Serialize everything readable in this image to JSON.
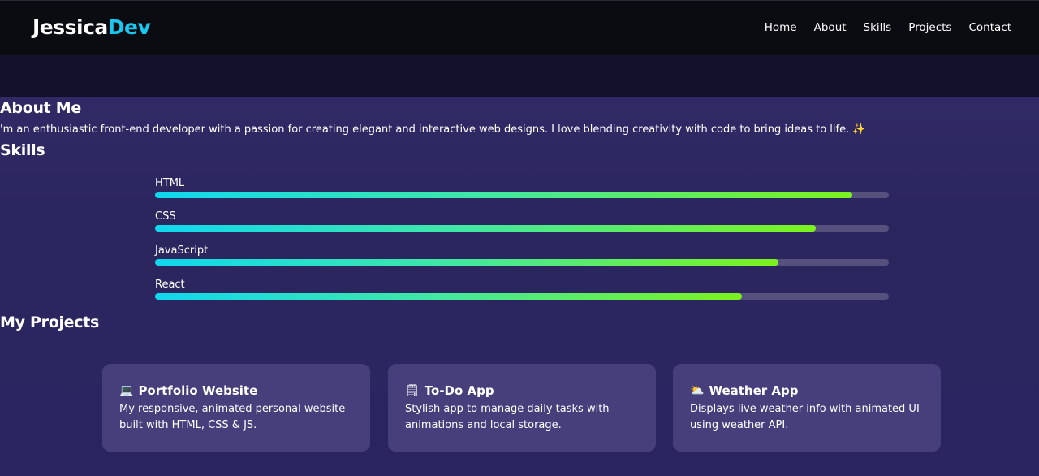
{
  "header": {
    "logo_part1": "Jessica",
    "logo_part2": "Dev",
    "nav": [
      "Home",
      "About",
      "Skills",
      "Projects",
      "Contact"
    ]
  },
  "about": {
    "heading": "About Me",
    "text": "'m an enthusiastic front-end developer with a passion for creating elegant and interactive web designs. I love blending creativity with code to bring ideas to life.",
    "sparkle": "✨"
  },
  "skills": {
    "heading": "Skills",
    "items": [
      {
        "label": "HTML",
        "level": 0.95
      },
      {
        "label": "CSS",
        "level": 0.9
      },
      {
        "label": "JavaScript",
        "level": 0.85
      },
      {
        "label": "React",
        "level": 0.8
      }
    ]
  },
  "projects": {
    "heading": "My Projects",
    "items": [
      {
        "icon": "💻",
        "icon_name": "laptop-icon",
        "title": "Portfolio Website",
        "desc": "My responsive, animated personal website built with HTML, CSS & JS."
      },
      {
        "icon": "🗒",
        "icon_name": "notepad-icon",
        "title": "To-Do App",
        "desc": "Stylish app to manage daily tasks with animations and local storage."
      },
      {
        "icon": "⛅",
        "icon_name": "weather-icon",
        "title": "Weather App",
        "desc": "Displays live weather info with animated UI using weather API."
      }
    ]
  },
  "colors": {
    "accent": "#19c8f0",
    "bar_start": "#10d7ee",
    "bar_end": "#7cf21d",
    "card_bg": "#463f7b"
  }
}
